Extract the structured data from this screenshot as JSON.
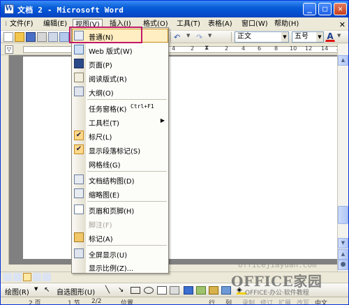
{
  "window": {
    "title": "文档 2 - Microsoft Word",
    "icon": "W"
  },
  "menubar": {
    "items": [
      "文件(F)",
      "编辑(E)",
      "视图(V)",
      "插入(I)",
      "格式(O)",
      "工具(T)",
      "表格(A)",
      "窗口(W)",
      "帮助(H)"
    ],
    "close_glyph": "✕"
  },
  "toolbar": {
    "style": "正文",
    "size": "五号",
    "font_color_letter": "A"
  },
  "ruler": {
    "numbers": [
      "4",
      "2",
      "2",
      "4",
      "6",
      "8",
      "10",
      "12",
      "14",
      "16"
    ]
  },
  "view_menu": {
    "items": [
      {
        "label": "普通(N)",
        "icon": "normal-view-icon",
        "highlighted": true
      },
      {
        "label": "Web 版式(W)",
        "icon": "web-layout-icon"
      },
      {
        "label": "页面(P)",
        "icon": "print-layout-icon"
      },
      {
        "label": "阅读版式(R)",
        "icon": "reading-layout-icon"
      },
      {
        "label": "大纲(O)",
        "icon": "outline-icon"
      },
      {
        "label": "任务窗格(K)",
        "shortcut": "Ctrl+F1"
      },
      {
        "label": "工具栏(T)",
        "submenu": "▶"
      },
      {
        "label": "标尺(L)",
        "checked": true
      },
      {
        "label": "显示段落标记(S)",
        "checked": true
      },
      {
        "label": "网格线(G)"
      },
      {
        "label": "文档结构图(D)",
        "icon": "document-map-icon"
      },
      {
        "label": "缩略图(E)",
        "icon": "thumbnails-icon"
      },
      {
        "label": "页眉和页脚(H)",
        "icon": "header-footer-icon"
      },
      {
        "label": "脚注(F)",
        "disabled": true
      },
      {
        "label": "标记(A)",
        "icon": "markup-icon"
      },
      {
        "label": "全屏显示(U)",
        "icon": "full-screen-icon"
      },
      {
        "label": "显示比例(Z)..."
      }
    ]
  },
  "drawing_toolbar": {
    "draw_label": "绘图(R)",
    "autoshapes_label": "自选图形(U)"
  },
  "status": {
    "page": "2 页",
    "section": "1 节",
    "pages": "2/2",
    "position": "位置",
    "line": "行",
    "col": "列",
    "rec": "录制",
    "trk": "修订",
    "ext": "扩展",
    "ovr": "改写",
    "lang": "中文"
  },
  "watermark": {
    "url": "officejiayuan.com",
    "brand": "OFFICE家园",
    "tagline": "OFFICE·办公·软件教程"
  },
  "colors": {
    "title_blue": "#0a5ed7",
    "highlight": "#ffeec2",
    "callout": "#c01868"
  }
}
